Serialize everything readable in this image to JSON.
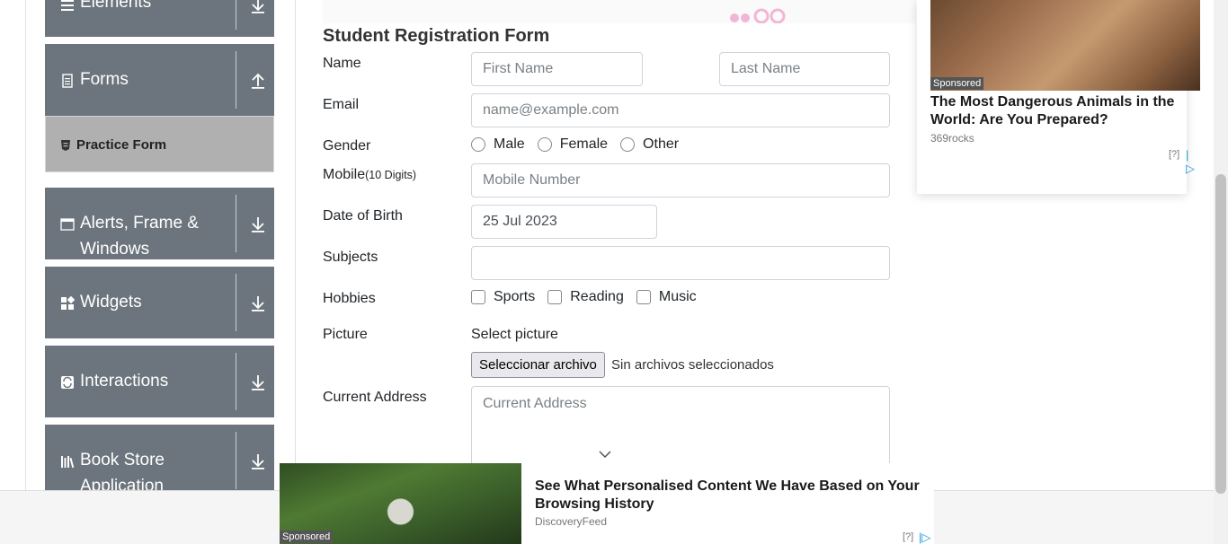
{
  "sidebar": {
    "groups": [
      {
        "title": "Elements",
        "icon": "list-icon",
        "arrow": "arrow-down-icon"
      },
      {
        "title": "Forms",
        "icon": "document-icon",
        "arrow": "arrow-up-icon"
      },
      {
        "title": "Alerts, Frame & Windows",
        "icon": "window-icon",
        "arrow": "arrow-down-icon"
      },
      {
        "title": "Widgets",
        "icon": "grid-icon",
        "arrow": "arrow-down-icon"
      },
      {
        "title": "Interactions",
        "icon": "sync-icon",
        "arrow": "arrow-down-icon"
      },
      {
        "title": "Book Store Application",
        "icon": "books-icon",
        "arrow": "arrow-down-icon"
      }
    ],
    "active_item": "Practice Form"
  },
  "form": {
    "title": "Student Registration Form",
    "name_label": "Name",
    "first_name_placeholder": "First Name",
    "last_name_placeholder": "Last Name",
    "email_label": "Email",
    "email_placeholder": "name@example.com",
    "gender_label": "Gender",
    "gender_options": [
      "Male",
      "Female",
      "Other"
    ],
    "mobile_label": "Mobile",
    "mobile_hint": "(10 Digits)",
    "mobile_placeholder": "Mobile Number",
    "dob_label": "Date of Birth",
    "dob_value": "25 Jul 2023",
    "subjects_label": "Subjects",
    "hobbies_label": "Hobbies",
    "hobby_options": [
      "Sports",
      "Reading",
      "Music"
    ],
    "picture_label": "Picture",
    "picture_prompt": "Select picture",
    "file_button": "Seleccionar archivo",
    "file_status": "Sin archivos seleccionados",
    "address_label": "Current Address",
    "address_placeholder": "Current Address"
  },
  "ads": {
    "side": {
      "sponsored": "Sponsored",
      "headline": "The Most Dangerous Animals in the World: Are You Prepared?",
      "source": "369rocks",
      "info": "[?]"
    },
    "bottom": {
      "sponsored": "Sponsored",
      "headline": "See What Personalised Content We Have Based on Your Browsing History",
      "source": "DiscoveryFeed",
      "info": "[?]"
    }
  }
}
